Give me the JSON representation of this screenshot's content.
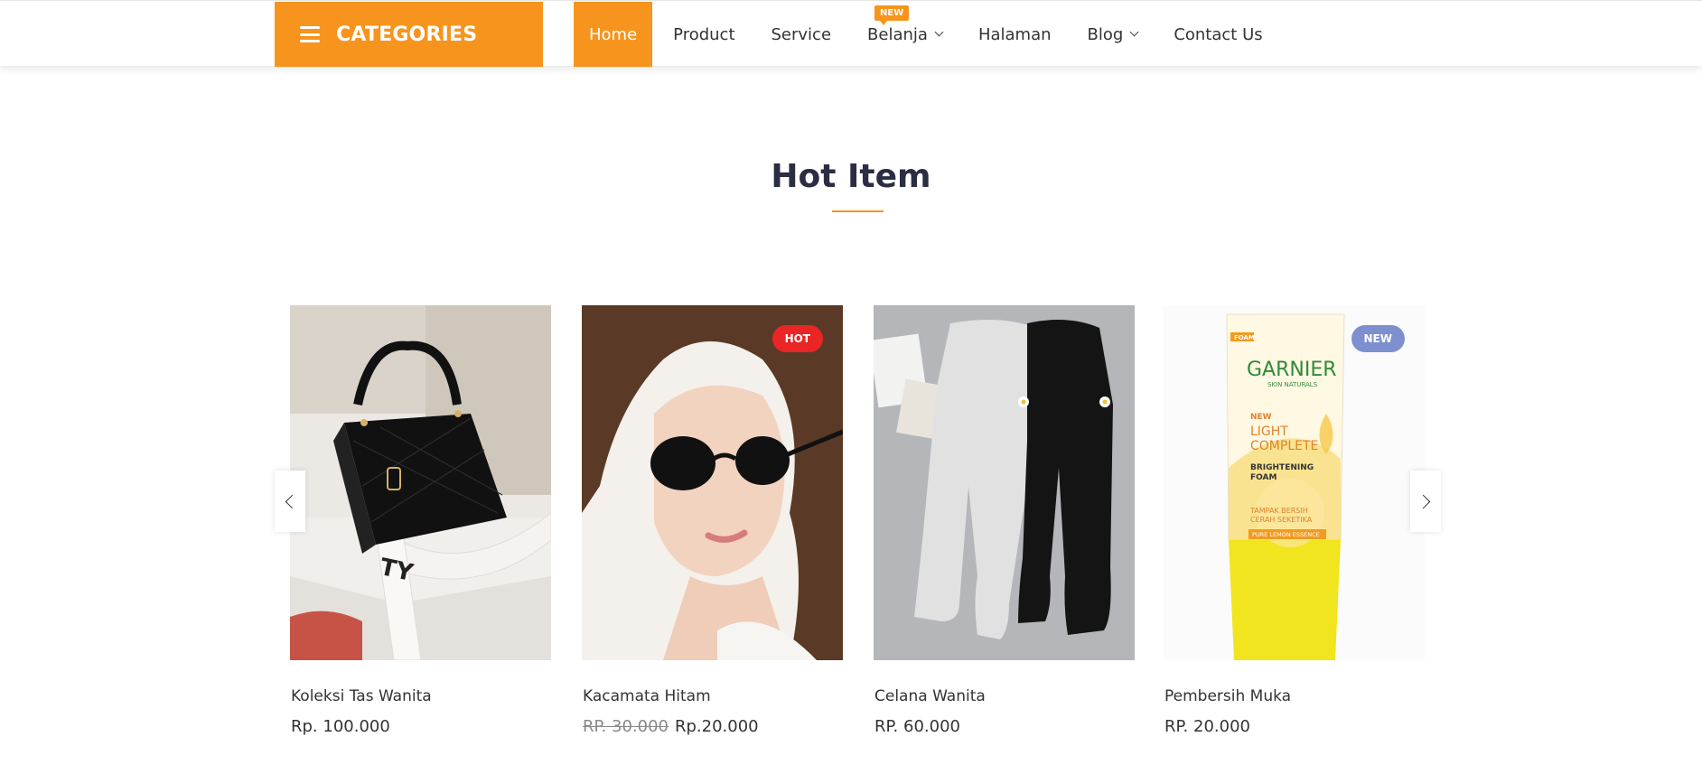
{
  "header": {
    "categories_label": "CATEGORIES",
    "nav": [
      {
        "label": "Home",
        "active": true
      },
      {
        "label": "Product"
      },
      {
        "label": "Service"
      },
      {
        "label": "Belanja",
        "badge": "NEW",
        "dropdown": true
      },
      {
        "label": "Halaman"
      },
      {
        "label": "Blog",
        "dropdown": true
      },
      {
        "label": "Contact Us"
      }
    ]
  },
  "section": {
    "title": "Hot Item"
  },
  "products": [
    {
      "name": "Koleksi Tas Wanita",
      "price": "Rp. 100.000"
    },
    {
      "name": "Kacamata Hitam",
      "old_price": "RP. 30.000",
      "price": "Rp.20.000",
      "badge": "HOT"
    },
    {
      "name": "Celana Wanita",
      "price": "RP. 60.000"
    },
    {
      "name": "Pembersih Muka",
      "price": "RP. 20.000",
      "badge": "NEW"
    }
  ],
  "product_image_text": {
    "brand": "GARNIER",
    "brand_sub": "SKIN NATURALS",
    "foam": "FOAM",
    "line1": "NEW",
    "line2": "LIGHT",
    "line3": "COMPLETE",
    "line4": "BRIGHTENING",
    "line5": "FOAM",
    "line6": "TAMPAK BERSIH",
    "line7": "CERAH SEKETIKA",
    "line8": "PURE LEMON ESSENCE"
  },
  "colors": {
    "accent": "#f7941d",
    "hot": "#e92525",
    "new": "#7d8fcf",
    "title": "#2b2d42"
  },
  "icons": {
    "categories": "hamburger-menu-icon",
    "dropdown": "chevron-down-icon",
    "prev": "chevron-left-icon",
    "next": "chevron-right-icon"
  }
}
